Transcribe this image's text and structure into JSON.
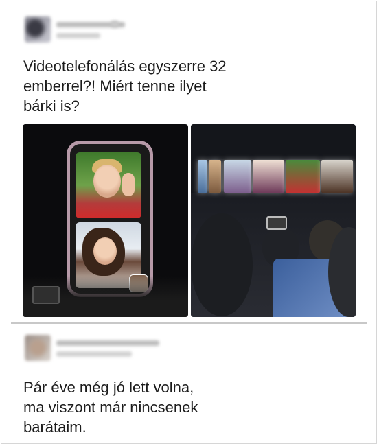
{
  "posts": [
    {
      "text_lines": [
        "Videotelefonálás egyszerre 32",
        "emberrel?! Miért tenne ilyet",
        "bárki is?"
      ]
    },
    {
      "text_lines": [
        "Pár éve még jó lett volna,",
        "ma viszont már nincsenek",
        "barátaim."
      ]
    }
  ]
}
